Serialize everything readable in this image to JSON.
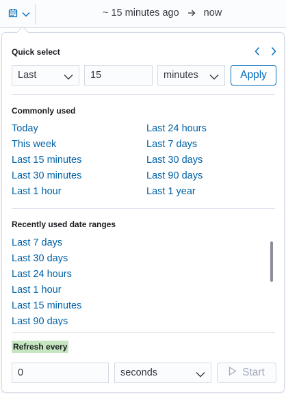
{
  "topbar": {
    "icons": {
      "calendar": "calendar-icon",
      "chevron": "chevron-down-icon",
      "arrow": "arrow-right-icon"
    },
    "start": "~ 15 minutes ago",
    "end": "now"
  },
  "quick_select": {
    "title": "Quick select",
    "direction": "Last",
    "value": "15",
    "unit": "minutes",
    "apply_label": "Apply"
  },
  "commonly_used": {
    "title": "Commonly used",
    "left": [
      "Today",
      "This week",
      "Last 15 minutes",
      "Last 30 minutes",
      "Last 1 hour"
    ],
    "right": [
      "Last 24 hours",
      "Last 7 days",
      "Last 30 days",
      "Last 90 days",
      "Last 1 year"
    ]
  },
  "recently_used": {
    "title": "Recently used date ranges",
    "items": [
      "Last 7 days",
      "Last 30 days",
      "Last 24 hours",
      "Last 1 hour",
      "Last 15 minutes",
      "Last 90 days"
    ]
  },
  "refresh": {
    "title": "Refresh every",
    "value": "0",
    "unit": "seconds",
    "start_label": "Start"
  },
  "colors": {
    "link": "#0061a6",
    "primary": "#006bb8",
    "highlight": "#c5e6c0",
    "disabled": "#a2abba"
  }
}
